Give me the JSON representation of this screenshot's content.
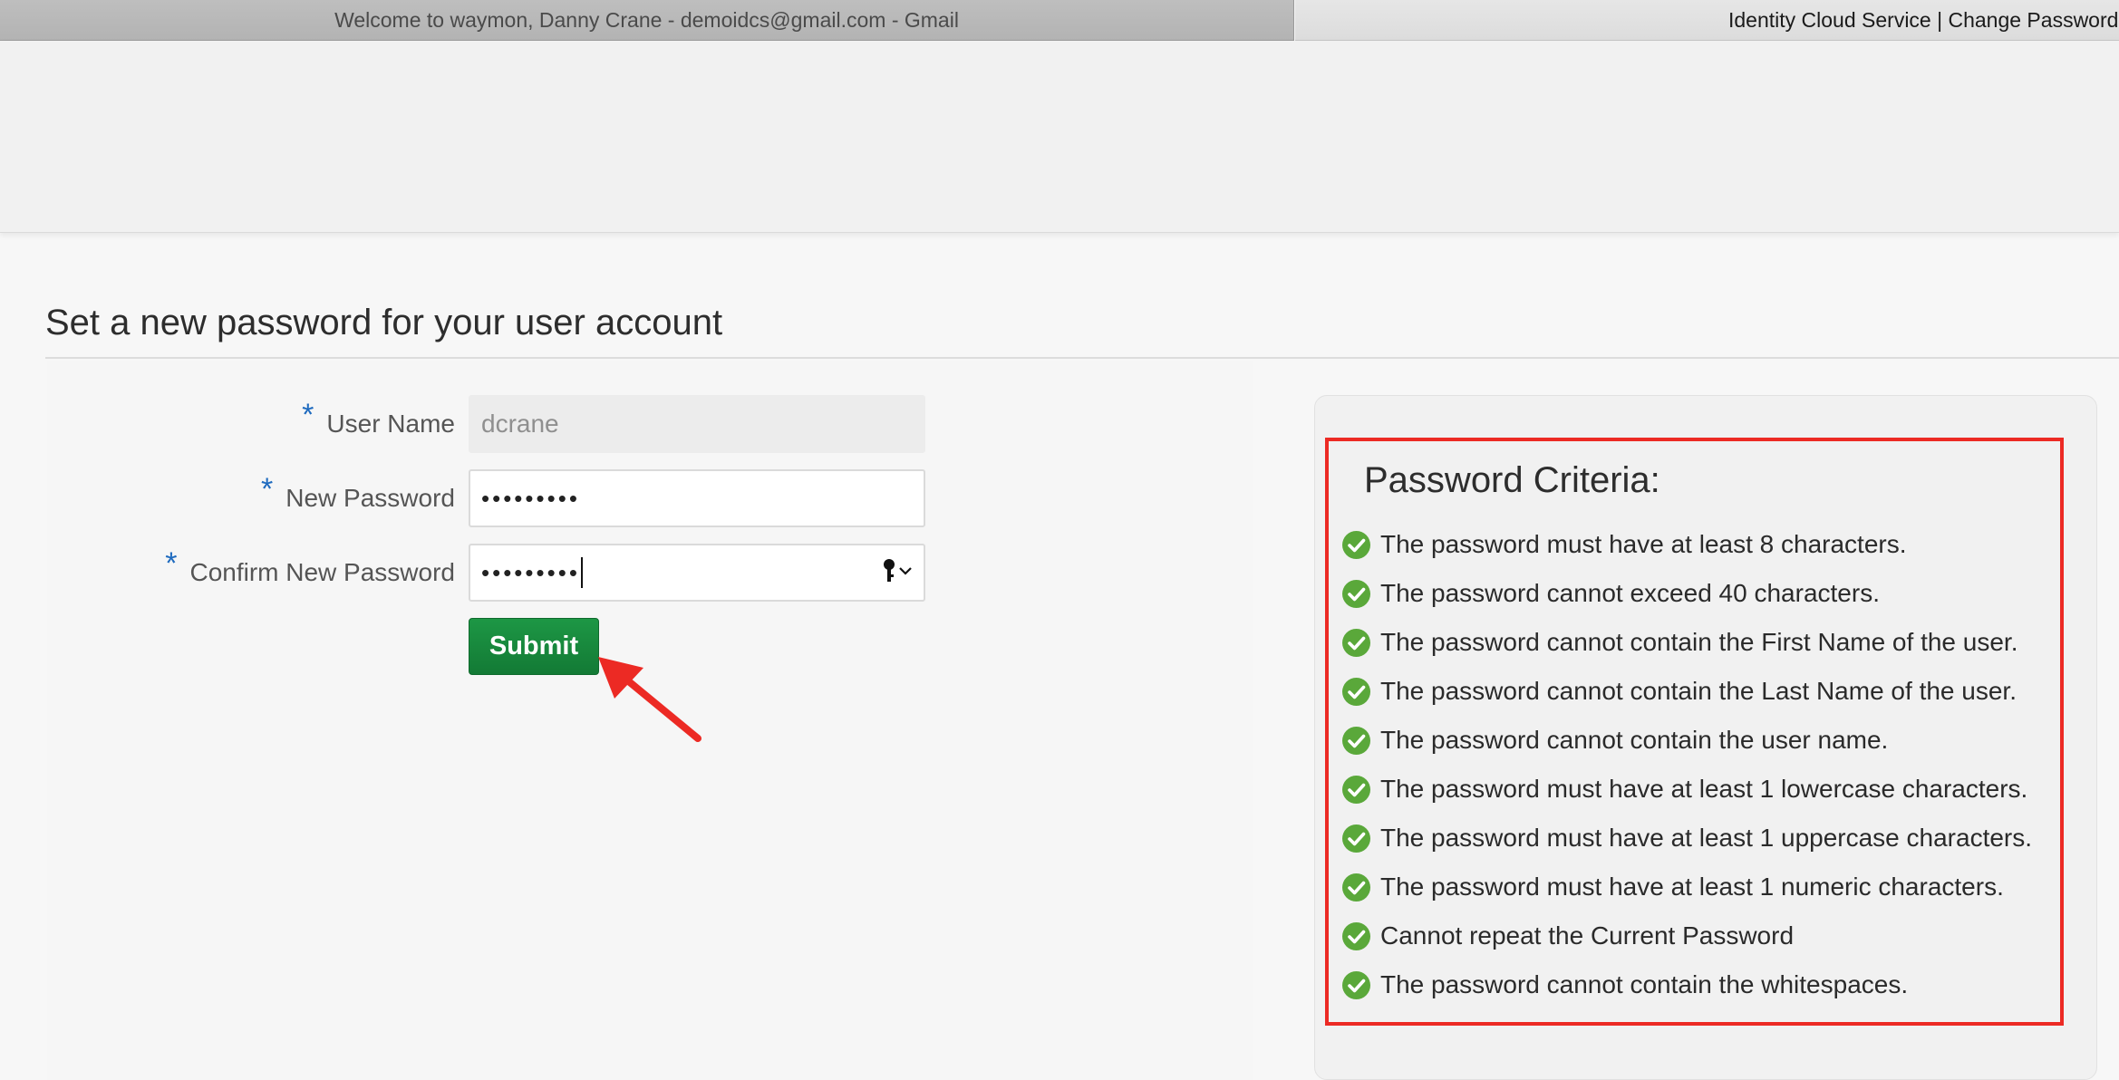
{
  "browser": {
    "tabs": [
      {
        "label": "Welcome to waymon, Danny Crane - demoidcs@gmail.com - Gmail",
        "active": false
      },
      {
        "label": "Identity Cloud Service | Change Password",
        "active": true
      }
    ]
  },
  "page": {
    "title": "Set a new password for your user account"
  },
  "form": {
    "required_marker": "*",
    "username": {
      "label": "User Name",
      "value": "dcrane"
    },
    "new_password": {
      "label": "New Password",
      "masked_value": "•••••••••"
    },
    "confirm_password": {
      "label": "Confirm New Password",
      "masked_value": "•••••••••"
    },
    "submit_label": "Submit"
  },
  "criteria": {
    "title": "Password Criteria:",
    "items": [
      "The password must have at least 8 characters.",
      "The password cannot exceed 40 characters.",
      "The password cannot contain the First Name of the user.",
      "The password cannot contain the Last Name of the user.",
      "The password cannot contain the user name.",
      "The password must have at least 1 lowercase characters.",
      "The password must have at least 1 uppercase characters.",
      "The password must have at least 1 numeric characters.",
      "Cannot repeat the Current Password",
      "The password cannot contain the whitespaces."
    ],
    "icon": "check-circle-icon",
    "check_color": "#5aa83a"
  },
  "colors": {
    "submit_button": "#188a3d",
    "annotation": "#ec2a24",
    "required_marker": "#1f6bbf"
  }
}
